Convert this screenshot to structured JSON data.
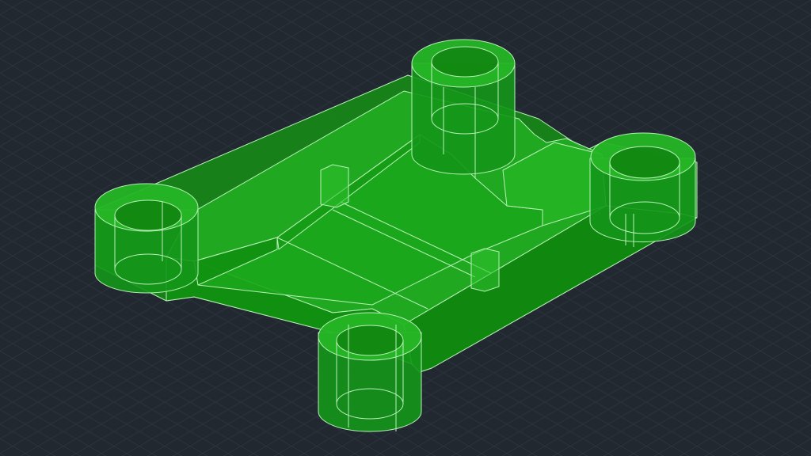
{
  "viewport": {
    "background": "#212830",
    "grid_color": "#2b343e",
    "grid": true,
    "projection": "isometric"
  },
  "model": {
    "shape": "rectangular plate with four cylindrical bosses",
    "fill_color": "#1a9f1a",
    "edge_color": "#b8f0b8",
    "style": "x-ray / transparent shaded"
  }
}
